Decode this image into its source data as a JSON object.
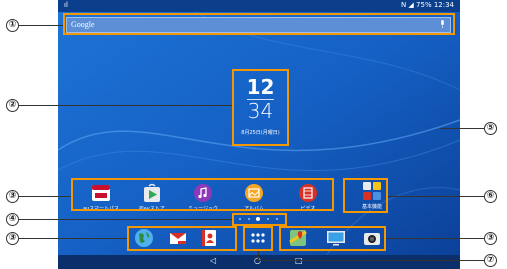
{
  "statusbar": {
    "left": "ıl",
    "right": "N ◢ 75% 12:34"
  },
  "search": {
    "label": "Google",
    "mic": "microphone-icon"
  },
  "clock": {
    "hour": "12",
    "minute": "34",
    "date": "8月25日(月曜日)"
  },
  "apps": [
    {
      "label": "auスマートパス",
      "icon": "au-smartpass-icon",
      "color": "#c8102e"
    },
    {
      "label": "Playストア",
      "icon": "play-store-icon",
      "color": "#34a853"
    },
    {
      "label": "ミュージック",
      "icon": "music-icon",
      "color": "#8e3ab8"
    },
    {
      "label": "アルバム",
      "icon": "album-icon",
      "color": "#f5a623"
    },
    {
      "label": "ビデオ",
      "icon": "video-icon",
      "color": "#d93025"
    }
  ],
  "folder": {
    "label": "基本機能",
    "icon": "basic-functions-folder-icon"
  },
  "dock": {
    "left": [
      {
        "icon": "browser-icon"
      },
      {
        "icon": "email-icon"
      },
      {
        "icon": "contacts-icon"
      }
    ],
    "app_tray": "app-tray-icon",
    "right": [
      {
        "icon": "maps-icon"
      },
      {
        "icon": "tv-icon"
      },
      {
        "icon": "camera-icon"
      }
    ]
  },
  "pages": {
    "count": 5,
    "current": 3
  },
  "nav": {
    "back": "◁",
    "home": "○",
    "recent": "□"
  },
  "callouts": [
    "①",
    "②",
    "③",
    "④",
    "③",
    "⑤",
    "⑥",
    "③",
    "⑦"
  ],
  "colors": {
    "wallpaper": "#1560c4",
    "highlight": "#f39800"
  }
}
